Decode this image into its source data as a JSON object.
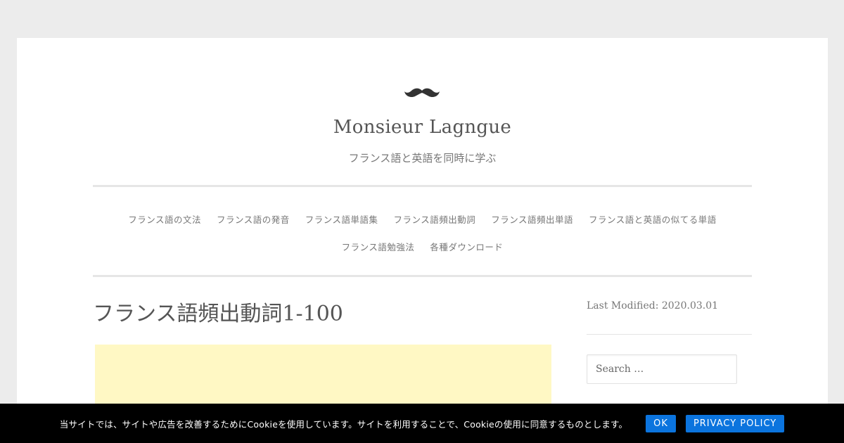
{
  "header": {
    "logo_icon": "mustache-icon",
    "site_title": "Monsieur Lagngue",
    "tagline": "フランス語と英語を同時に学ぶ"
  },
  "nav": {
    "row1": [
      "フランス語の文法",
      "フランス語の発音",
      "フランス語単語集",
      "フランス語頻出動詞",
      "フランス語頻出単語",
      "フランス語と英語の似てる単語"
    ],
    "row2": [
      "フランス語勉強法",
      "各種ダウンロード"
    ]
  },
  "post": {
    "title": "フランス語頻出動詞1-100"
  },
  "sidebar": {
    "last_modified": "Last Modified: 2020.03.01",
    "search_placeholder": "Search …"
  },
  "cookie_notice": {
    "text": "当サイトでは、サイトや広告を改善するためにCookieを使用しています。サイトを利用することで、Cookieの使用に同意するものとします。",
    "ok_label": "OK",
    "privacy_label": "PRIVACY POLICY"
  },
  "colors": {
    "page_bg": "#ececec",
    "content_bg": "#ffffff",
    "ad_bg": "#fff8c4",
    "cookie_bar_bg": "#000000",
    "button_bg": "#0b74de"
  }
}
